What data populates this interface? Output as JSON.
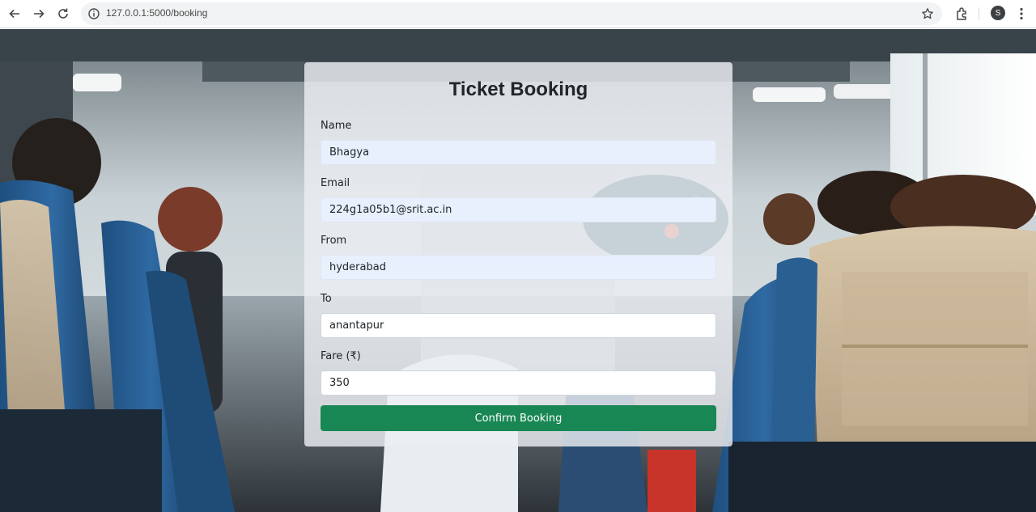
{
  "browser": {
    "url": "127.0.0.1:5000/booking",
    "profile_initial": "S"
  },
  "form": {
    "title": "Ticket Booking",
    "fields": [
      {
        "label": "Name",
        "value": "Bhagya"
      },
      {
        "label": "Email",
        "value": "224g1a05b1@srit.ac.in"
      },
      {
        "label": "From",
        "value": "hyderabad"
      },
      {
        "label": "To",
        "value": "anantapur"
      },
      {
        "label": "Fare (₹)",
        "value": "350"
      }
    ],
    "submit_label": "Confirm Booking"
  },
  "colors": {
    "button": "#198754",
    "autofill": "#e8f0fe"
  }
}
